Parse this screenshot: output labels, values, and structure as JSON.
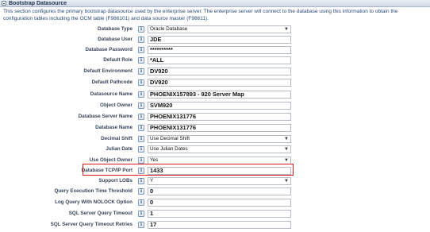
{
  "section": {
    "title": "Bootstrap Datasource",
    "description": "This section configures the primary bootstrap datasource used by the enterprise server. The enterprise server will connect to the database using this information to obtain the configuration tables including the OCM table (F986101) and data source master (F98611)."
  },
  "fields": [
    {
      "label": "Database Type",
      "type": "select",
      "value": "Oracle Database"
    },
    {
      "label": "Database User",
      "type": "text",
      "value": "JDE"
    },
    {
      "label": "Database Password",
      "type": "text",
      "value": "**********"
    },
    {
      "label": "Default Role",
      "type": "text",
      "value": "*ALL"
    },
    {
      "label": "Default Environment",
      "type": "text",
      "value": "DV920"
    },
    {
      "label": "Default Pathcode",
      "type": "text",
      "value": "DV920"
    },
    {
      "label": "Datasource Name",
      "type": "text",
      "value": "PHOENIX157893 - 920 Server Map"
    },
    {
      "label": "Object Owner",
      "type": "text",
      "value": "SVM920"
    },
    {
      "label": "Database Server Name",
      "type": "text",
      "value": "PHOENIX131776"
    },
    {
      "label": "Database Name",
      "type": "text",
      "value": "PHOENIX131776"
    },
    {
      "label": "Decimal Shift",
      "type": "select",
      "value": "Use Decimal Shift"
    },
    {
      "label": "Julian Date",
      "type": "select",
      "value": "Use Julian Dates"
    },
    {
      "label": "Use Object Owner",
      "type": "select",
      "value": "Yes"
    },
    {
      "label": "Database TCP/IP Port",
      "type": "text",
      "value": "1433",
      "highlighted": true
    },
    {
      "label": "Support LOBs",
      "type": "select",
      "value": "Y"
    },
    {
      "label": "Query Execution Time Threshold",
      "type": "text",
      "value": "0"
    },
    {
      "label": "Log Query With NOLOCK Option",
      "type": "text",
      "value": "0"
    },
    {
      "label": "SQL Server Query Timeout",
      "type": "text",
      "value": "1"
    },
    {
      "label": "SQL Server Query Timeout Retries",
      "type": "text",
      "value": "17"
    }
  ],
  "icons": {
    "info": "i",
    "dropdown": "▼"
  },
  "colors": {
    "highlight": "#e0141e",
    "description_text": "#2b4a78"
  }
}
